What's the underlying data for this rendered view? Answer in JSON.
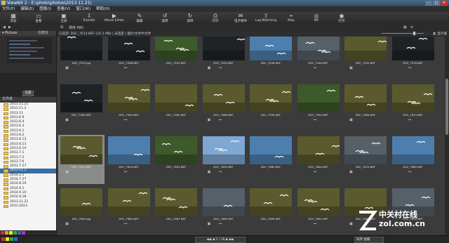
{
  "window": {
    "title": "ViewNX 2 - E:\\photo\\photos\\2013.11.21\\",
    "min": "–",
    "max": "□",
    "close": "✕"
  },
  "menu": [
    "文件(F)",
    "编辑(E)",
    "图像(I)",
    "查看(V)",
    "窗口(W)",
    "帮助(H)"
  ],
  "toolbar": [
    {
      "icon": "browser-icon",
      "glyph": "▦",
      "label": "浏览"
    },
    {
      "icon": "viewer-icon",
      "glyph": "▭",
      "label": "查看"
    },
    {
      "icon": "fullscreen-icon",
      "glyph": "▣",
      "label": "全屏"
    },
    {
      "icon": "transfer-icon",
      "glyph": "⇩",
      "label": "Transfer"
    },
    {
      "icon": "movie-editor-icon",
      "glyph": "▶",
      "label": "Movie Editor"
    },
    {
      "icon": "edit-icon",
      "glyph": "✎",
      "label": "编辑"
    },
    {
      "icon": "rotate-left-icon",
      "glyph": "↺",
      "label": "旋转"
    },
    {
      "icon": "rotate-right-icon",
      "glyph": "↻",
      "label": "旋转"
    },
    {
      "icon": "print-icon",
      "glyph": "⎙",
      "label": "打印"
    },
    {
      "icon": "mail-icon",
      "glyph": "✉",
      "label": "电子邮件"
    },
    {
      "icon": "upload-icon",
      "glyph": "⇧",
      "label": "Log Matching"
    },
    {
      "icon": "map-icon",
      "glyph": "⌖",
      "label": "Map"
    },
    {
      "icon": "nikon-icon",
      "glyph": "◎",
      "label": "NX"
    },
    {
      "icon": "capture-icon",
      "glyph": "◉",
      "label": "打开"
    }
  ],
  "subtool": {
    "back": "◀",
    "forward": "▶",
    "sort_label": "排序 RRC",
    "filter": "⊞",
    "grid_view": "▦",
    "list_view": "≡"
  },
  "left_panel": {
    "tab1": "▾ Picture",
    "tab2": "收藏夹",
    "button": "设置",
    "folder_header": "文件夹"
  },
  "folders": [
    "2013.11.21",
    "2013.11.2",
    "2013.11",
    "2013.6.9",
    "2013.6.4",
    "2013.6.3",
    "2013.6.1",
    "2013.6.2",
    "2013.6.12",
    "2013.6.13",
    "2013.6.14",
    "2013.7.1",
    "2013.7.2",
    "2013.7.6",
    "2013.7.27",
    "2013.11.2",
    "2014.2.1",
    "2014.7.27",
    "2014.8.19",
    "2014.9.1",
    "2014.9.10",
    "2014.9.18",
    "2013.11.21",
    "2013.2013"
  ],
  "selected_folder_index": 15,
  "grid": {
    "path": "已选定: DSC_7614.NEF (24.3 MB) | 未选定 | 图片/文件中文件",
    "inspector": "◧ 显示器",
    "rows": [
      [
        {
          "name": "DSC_7537.jpg",
          "t": "dark"
        },
        {
          "name": "DSC_7538.NEF",
          "t": "dark"
        },
        {
          "name": "DSC_7542.NEF",
          "t": "green"
        },
        {
          "name": "DSC_7544.NEF",
          "t": "dark"
        },
        {
          "name": "DSC_7546.NEF",
          "t": "blue"
        },
        {
          "name": "DSC_7548.NEF",
          "t": "gray"
        },
        {
          "name": "DSC_7550.NEF",
          "t": "olive"
        },
        {
          "name": "DSC_7576.NEF",
          "t": "dark"
        }
      ],
      [
        {
          "name": "DSC_7580.NEF",
          "t": "dark"
        },
        {
          "name": "DSC_7584.NEF",
          "t": "olive"
        },
        {
          "name": "DSC_7585.NEF",
          "t": "olive"
        },
        {
          "name": "DSC_7586.NEF",
          "t": "olive"
        },
        {
          "name": "DSC_7590.NEF",
          "t": "olive"
        },
        {
          "name": "DSC_7594.NEF",
          "t": "green"
        },
        {
          "name": "DSC_7606.NEF",
          "t": "olive"
        },
        {
          "name": "DSC_7613.NEF",
          "t": "olive"
        }
      ],
      [
        {
          "name": "DSC_7614.NEF",
          "t": "olive"
        },
        {
          "name": "DSC_7620.NEF",
          "t": "blue"
        },
        {
          "name": "DSC_7624.NEF",
          "t": "green"
        },
        {
          "name": "DSC_7655.NEF",
          "t": "sky"
        },
        {
          "name": "DSC_7660.NEF",
          "t": "blue"
        },
        {
          "name": "DSC_7664.NEF",
          "t": "olive"
        },
        {
          "name": "DSC_7670.NEF",
          "t": "gray"
        },
        {
          "name": "DSC_7680.NEF",
          "t": "blue"
        }
      ],
      [
        {
          "name": "DSC_7683.jpg",
          "t": "olive"
        },
        {
          "name": "DSC_7685.NEF",
          "t": "olive"
        },
        {
          "name": "DSC_7687.NEF",
          "t": "olive"
        },
        {
          "name": "DSC_7689.NEF",
          "t": "gray"
        },
        {
          "name": "DSC_7690.NEF",
          "t": "olive"
        },
        {
          "name": "DSC_7692.NEF",
          "t": "olive"
        },
        {
          "name": "DSC_7694.NEF",
          "t": "olive"
        },
        {
          "name": "DSC_7695.NEF",
          "t": "gray"
        }
      ]
    ]
  },
  "status": {
    "pager": "◀◀  ◀  1 / 36  ▶  ▶▶",
    "sort": "排序 拍摄"
  },
  "watermark": {
    "line1": "中关村在线",
    "line2": "zol.com.cn"
  },
  "colors": {
    "dark": "#1f2326",
    "green": "#3d5a2a",
    "olive": "#5a5a2e",
    "blue": "#4d7fae",
    "sky": "#7fa7d3",
    "gray": "#556068",
    "selected": "#8a8a8a",
    "folder_sel": "#3a6ea5"
  }
}
